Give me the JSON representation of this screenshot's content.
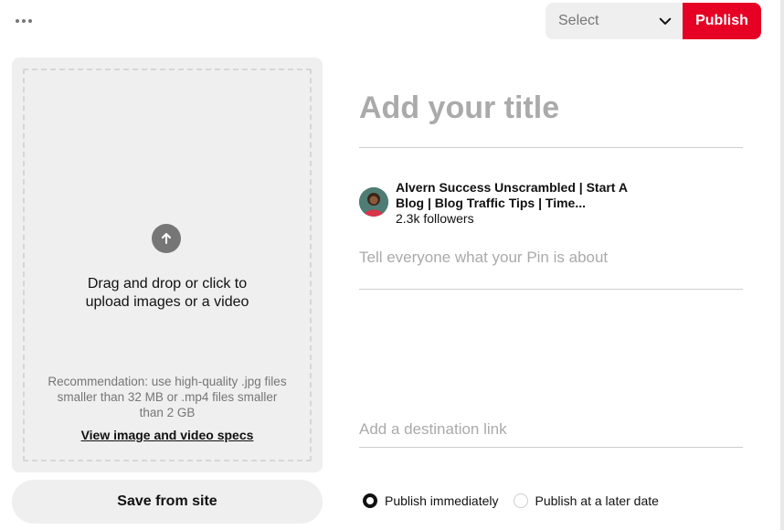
{
  "header": {
    "more_icon": "ellipsis-icon",
    "board_select": {
      "placeholder": "Select",
      "icon": "chevron-down-icon"
    },
    "publish_label": "Publish"
  },
  "upload": {
    "icon": "arrow-up-circle-icon",
    "instruction_line1": "Drag and drop or click to",
    "instruction_line2": "upload images or a video",
    "recommendation": "Recommendation: use high-quality .jpg files smaller than 32 MB or .mp4 files smaller than 2 GB",
    "specs_link": "View image and video specs",
    "save_from_site": "Save from site"
  },
  "pin_form": {
    "title_placeholder": "Add your title",
    "account": {
      "name_line1": "Alvern Success Unscrambled | Start A",
      "name_line2": "Blog | Blog Traffic Tips | Time...",
      "followers": "2.3k followers"
    },
    "description_placeholder": "Tell everyone what your Pin is about",
    "link_placeholder": "Add a destination link",
    "publish_options": [
      {
        "label": "Publish immediately",
        "selected": true
      },
      {
        "label": "Publish at a later date",
        "selected": false
      }
    ]
  },
  "colors": {
    "brand_red": "#e60023",
    "panel_gray": "#efefef",
    "placeholder_gray": "#aaaaaa",
    "muted_text": "#767676"
  }
}
